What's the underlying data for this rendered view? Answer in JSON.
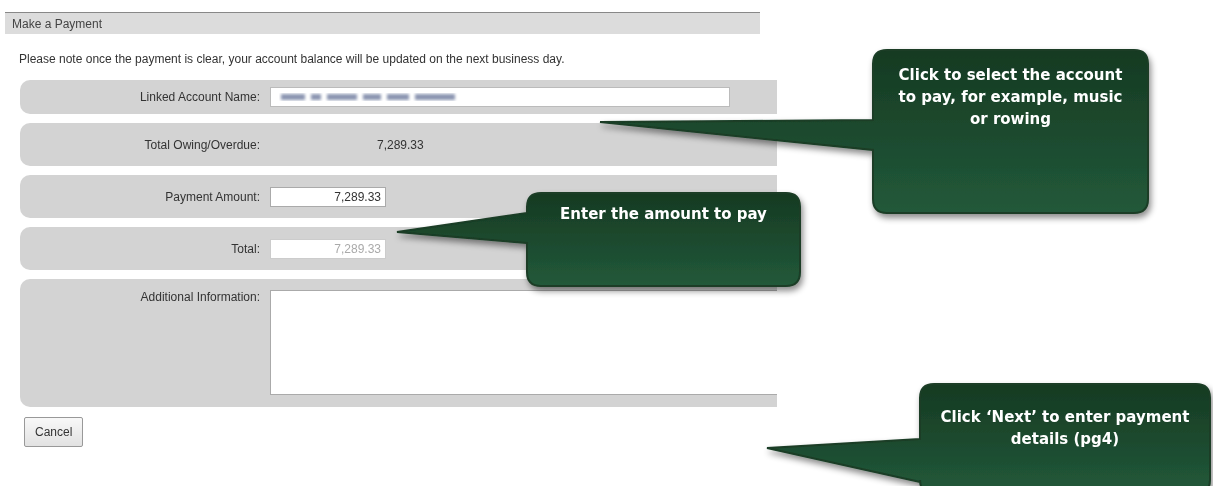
{
  "panel": {
    "title": "Make a Payment"
  },
  "notice": "Please note once the payment is clear, your account balance will be updated on the next business day.",
  "fields": [
    {
      "label": "Linked Account Name:",
      "kind": "select"
    },
    {
      "label": "Total Owing/Overdue:",
      "kind": "text",
      "value": "7,289.33"
    },
    {
      "label": "Payment Amount:",
      "kind": "input",
      "value": "7,289.33",
      "disabled": false
    },
    {
      "label": "Total:",
      "kind": "input",
      "value": "7,289.33",
      "disabled": true
    },
    {
      "label": "Additional Information:",
      "kind": "textarea"
    }
  ],
  "buttons": [
    "Cancel"
  ],
  "callouts": [
    {
      "text": "Click to select the account to pay, for example, music or rowing"
    },
    {
      "text": "Enter the amount to pay"
    },
    {
      "text": "Click ‘Next’ to enter payment details (pg4)"
    }
  ]
}
